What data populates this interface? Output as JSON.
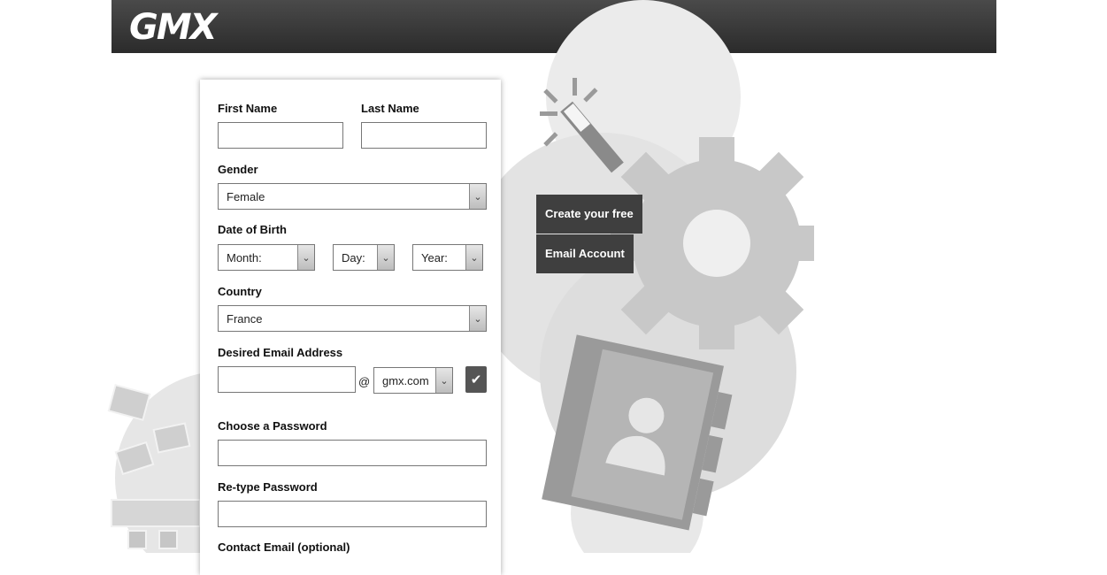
{
  "header": {
    "logo_text": "GMX"
  },
  "form": {
    "first_name_label": "First Name",
    "last_name_label": "Last Name",
    "gender_label": "Gender",
    "gender_value": "Female",
    "dob_label": "Date of Birth",
    "month_value": "Month:",
    "day_value": "Day:",
    "year_value": "Year:",
    "country_label": "Country",
    "country_value": "France",
    "email_label": "Desired Email Address",
    "at_symbol": "@",
    "domain_value": "gmx.com",
    "password_label": "Choose a Password",
    "retype_label": "Re-type Password",
    "contact_label": "Contact Email (optional)"
  },
  "promo": {
    "line1": "Create your free",
    "line2": "Email Account"
  },
  "icons": {
    "check": "check-icon",
    "dropdown": "chevron-down-icon"
  }
}
